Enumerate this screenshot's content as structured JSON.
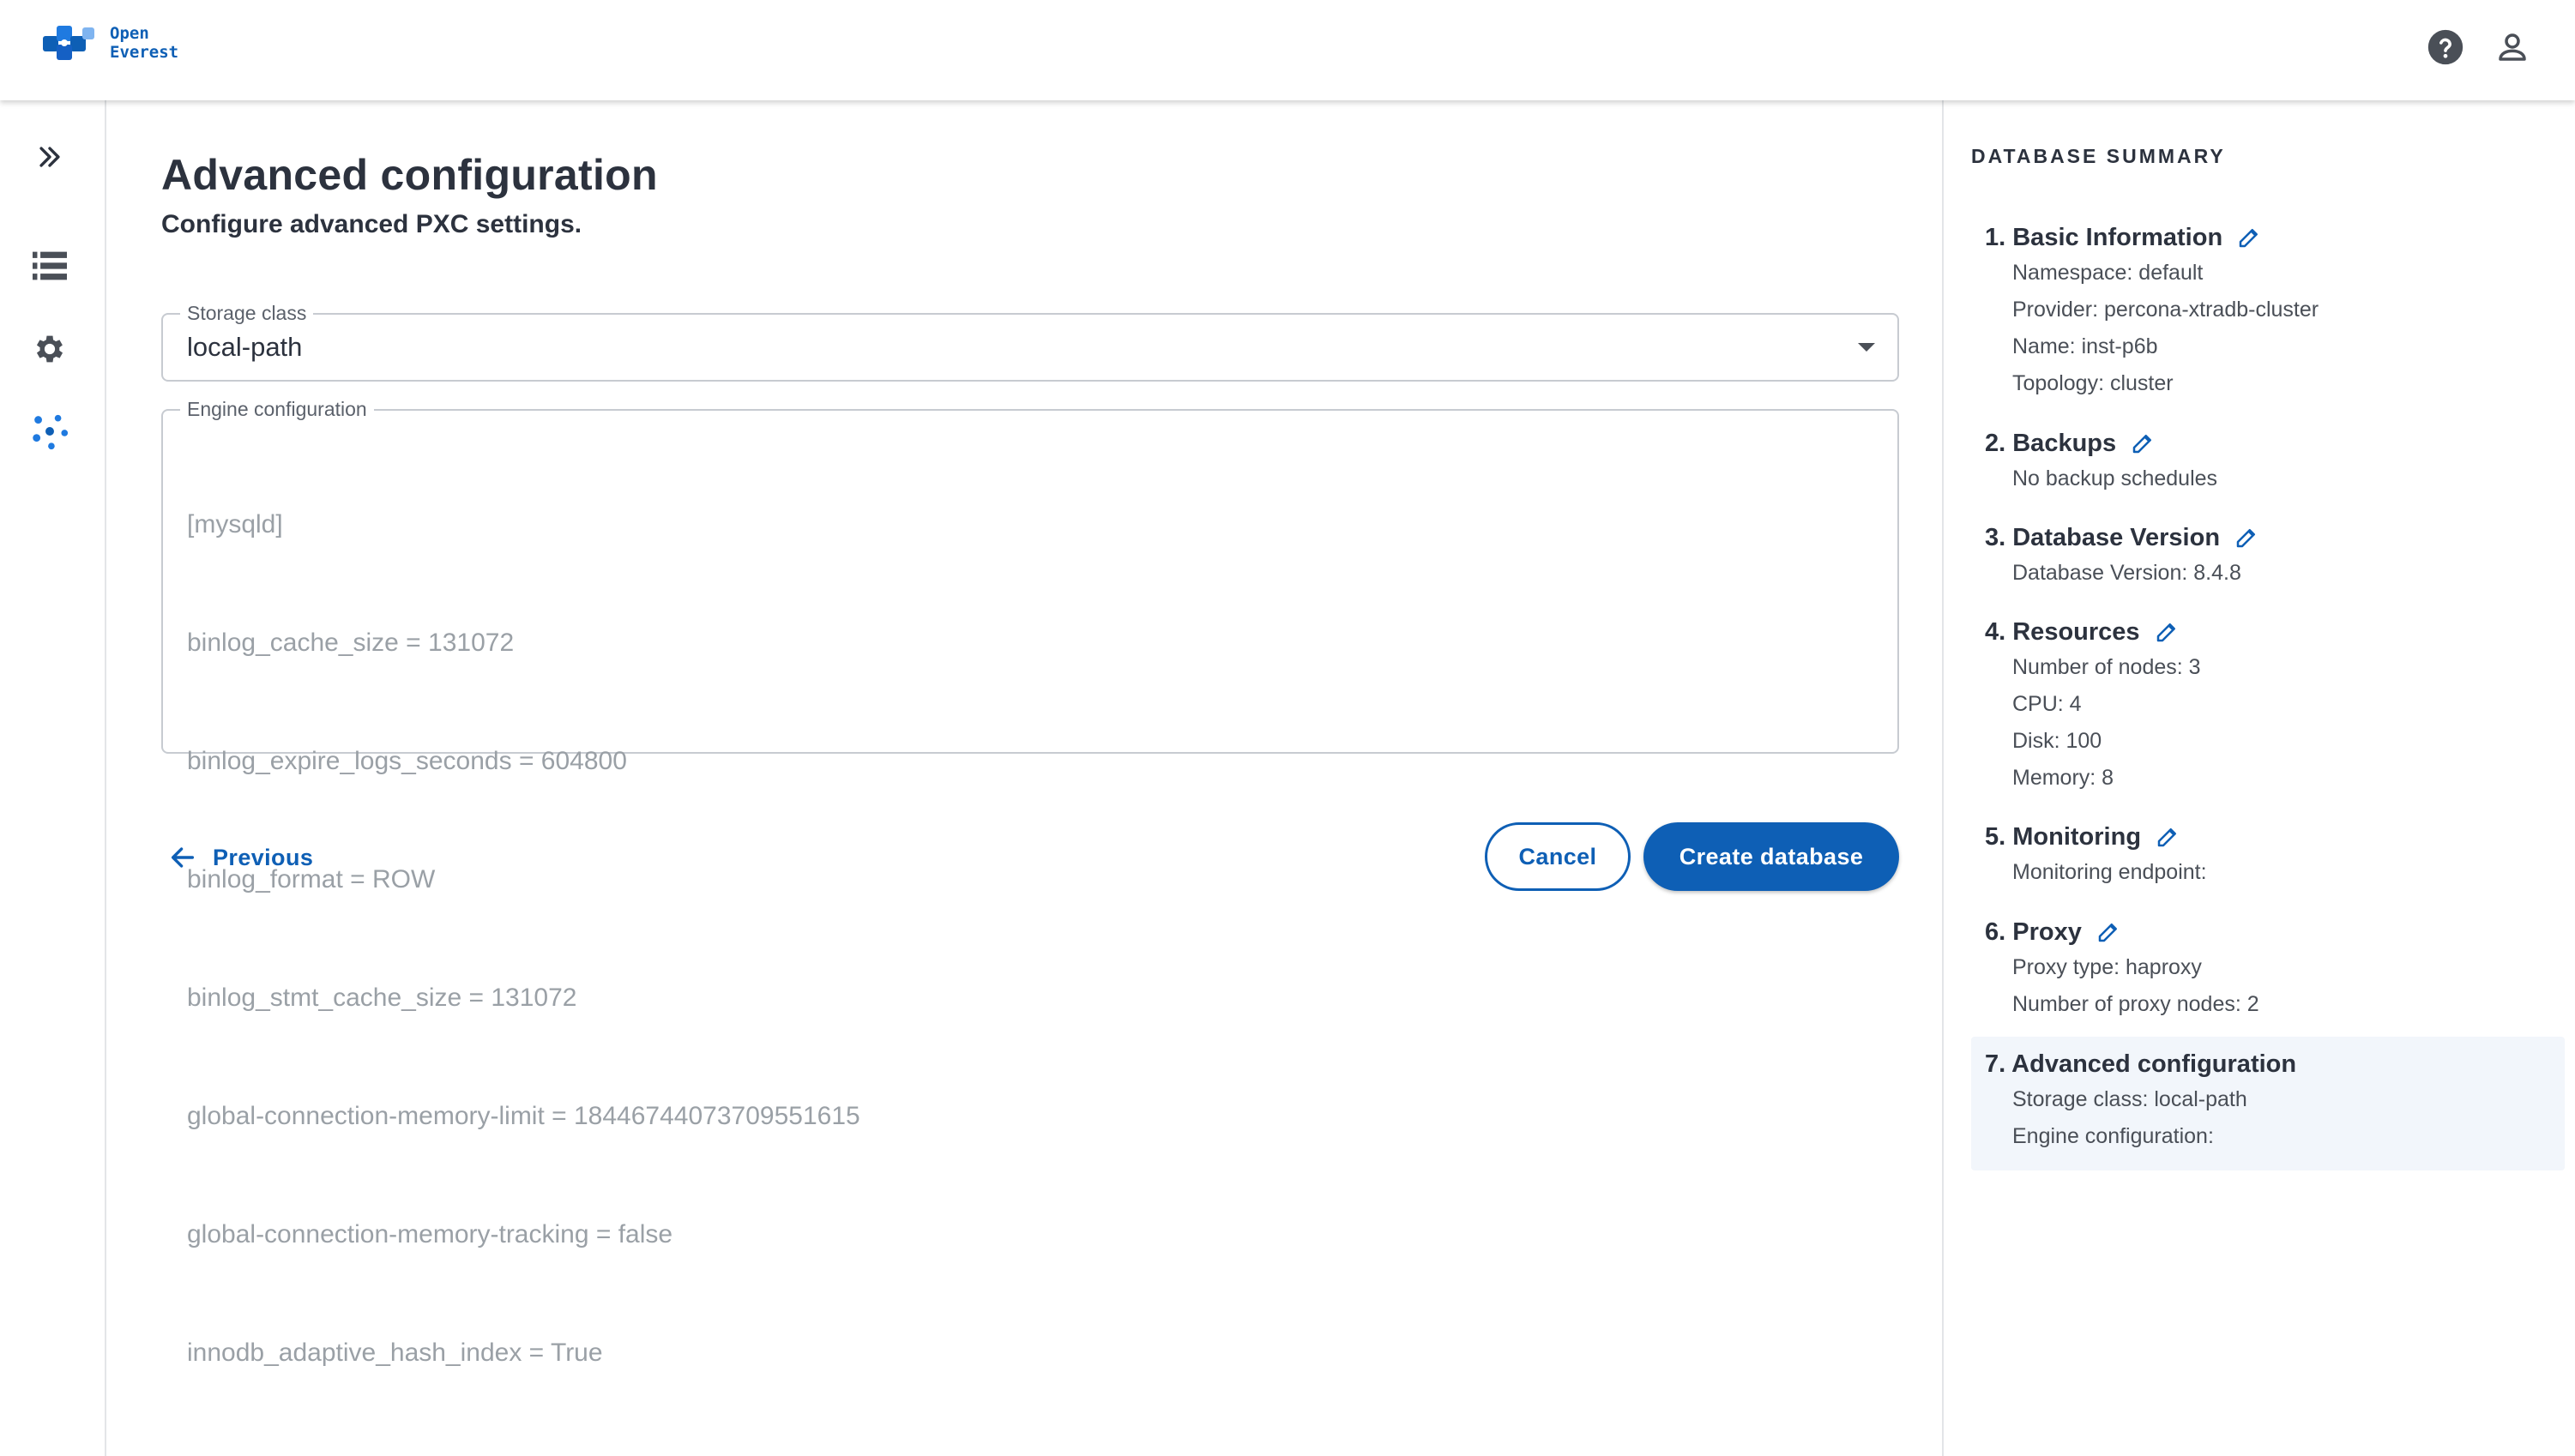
{
  "header": {
    "logo_line1": "Open",
    "logo_line2": "Everest"
  },
  "main": {
    "title": "Advanced configuration",
    "subtitle": "Configure advanced PXC settings.",
    "storage_class": {
      "label": "Storage class",
      "value": "local-path"
    },
    "engine_config": {
      "label": "Engine configuration",
      "lines": [
        "[mysqld]",
        "binlog_cache_size = 131072",
        "binlog_expire_logs_seconds = 604800",
        "binlog_format = ROW",
        "binlog_stmt_cache_size = 131072",
        "global-connection-memory-limit = 18446744073709551615",
        "global-connection-memory-tracking = false",
        "innodb_adaptive_hash_index = True"
      ]
    },
    "previous_label": "Previous",
    "cancel_label": "Cancel",
    "create_label": "Create database"
  },
  "summary": {
    "title": "DATABASE SUMMARY",
    "sections": [
      {
        "heading": "1. Basic Information",
        "lines": [
          "Namespace: default",
          "Provider: percona-xtradb-cluster",
          "Name: inst-p6b",
          "Topology: cluster"
        ]
      },
      {
        "heading": "2. Backups",
        "lines": [
          "No backup schedules"
        ]
      },
      {
        "heading": "3. Database Version",
        "lines": [
          "Database Version: 8.4.8"
        ]
      },
      {
        "heading": "4. Resources",
        "lines": [
          "Number of nodes: 3",
          "CPU: 4",
          "Disk: 100",
          "Memory: 8"
        ]
      },
      {
        "heading": "5. Monitoring",
        "lines": [
          "Monitoring endpoint:"
        ]
      },
      {
        "heading": "6. Proxy",
        "lines": [
          "Proxy type: haproxy",
          "Number of proxy nodes: 2"
        ]
      },
      {
        "heading": "7. Advanced configuration",
        "lines": [
          "Storage class: local-path",
          "Engine configuration:"
        ]
      }
    ]
  },
  "colors": {
    "accent": "#0e5fb5",
    "text": "#2c323e",
    "muted": "#9aa0a6",
    "active_bg": "#f2f6fb"
  },
  "icons": {
    "help": "help-circle-icon",
    "user": "user-account-icon",
    "expand": "double-chevron-right-icon",
    "databases": "database-list-icon",
    "settings": "gear-icon",
    "namespaces": "nodes-dots-icon",
    "edit": "pencil-icon",
    "back": "arrow-left-icon"
  }
}
